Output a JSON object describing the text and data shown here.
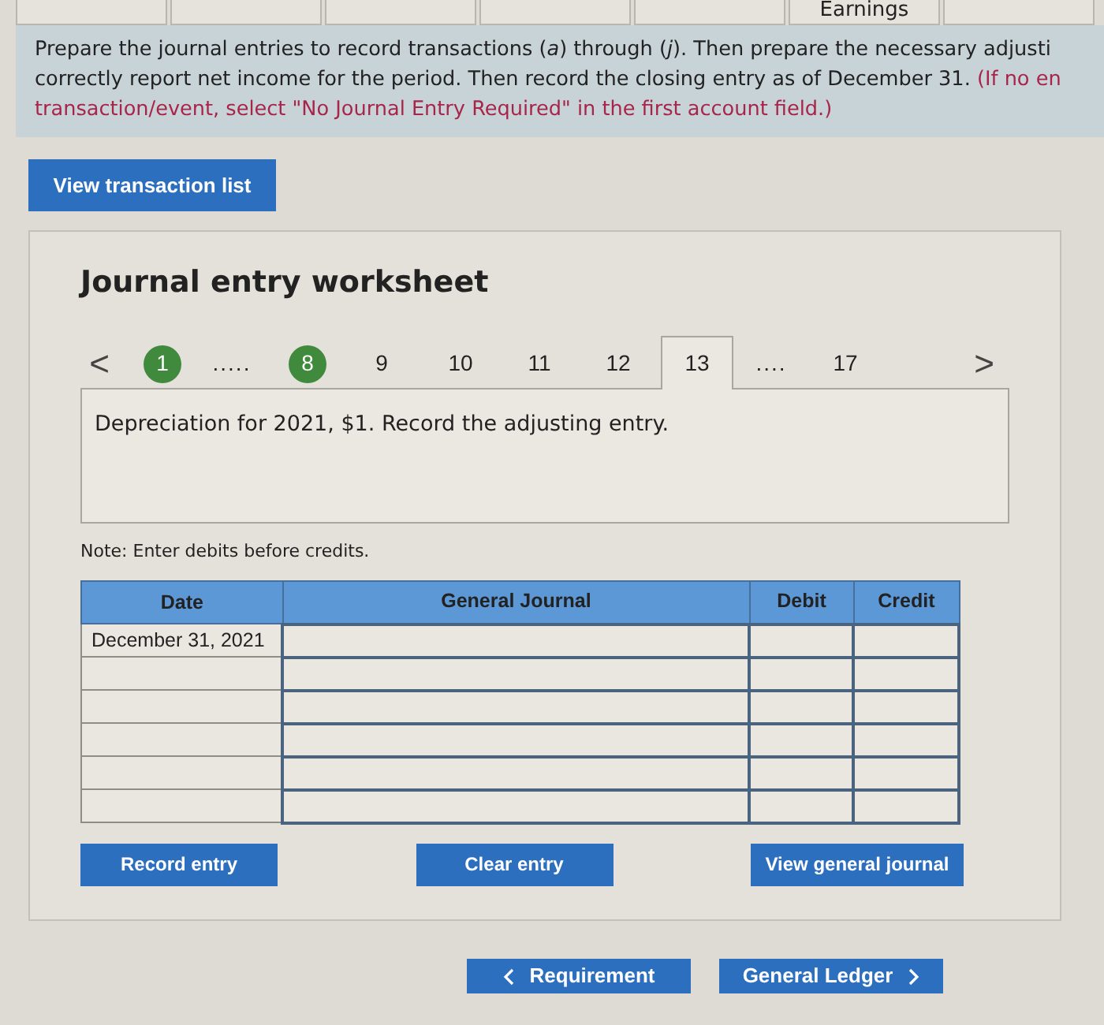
{
  "top_tabs": [
    {
      "kind": "cut"
    },
    {
      "kind": "cut"
    },
    {
      "kind": "cut"
    },
    {
      "kind": "cut"
    },
    {
      "kind": "cut"
    },
    {
      "kind": "label",
      "label": "Earnings"
    },
    {
      "kind": "cut"
    }
  ],
  "instructions": {
    "lines": [
      "Prepare the journal entries to record transactions (*a*) through (*j*). Then prepare the necessary adjusti",
      "correctly report net income for the period. Then record the closing entry as of December 31."
    ],
    "note_lines": [
      "(If no en",
      "transaction/event, select \"No Journal Entry Required\" in the first account field.)"
    ]
  },
  "view_transactions_button": "View transaction list",
  "worksheet": {
    "title": "Journal entry worksheet",
    "pager": [
      {
        "kind": "prev",
        "label": "<"
      },
      {
        "kind": "done",
        "label": "1"
      },
      {
        "kind": "dots",
        "label": "....."
      },
      {
        "kind": "done",
        "label": "8"
      },
      {
        "kind": "number",
        "label": "9",
        "selected": false
      },
      {
        "kind": "number",
        "label": "10",
        "selected": false
      },
      {
        "kind": "number",
        "label": "11",
        "selected": false
      },
      {
        "kind": "number",
        "label": "12",
        "selected": false
      },
      {
        "kind": "number",
        "label": "13",
        "selected": true
      },
      {
        "kind": "dots",
        "label": "...."
      },
      {
        "kind": "number",
        "label": "17",
        "selected": false
      },
      {
        "kind": "next",
        "label": ">"
      }
    ],
    "description": "Depreciation for 2021, $1. Record the adjusting entry.",
    "note": "Note: Enter debits before credits.",
    "table": {
      "columns": [
        "Date",
        "General Journal",
        "Debit",
        "Credit"
      ],
      "rows": [
        {
          "date": "December 31, 2021"
        },
        {
          "date": ""
        },
        {
          "date": ""
        },
        {
          "date": ""
        },
        {
          "date": ""
        },
        {
          "date": ""
        }
      ]
    },
    "buttons": [
      "Record entry",
      "Clear entry",
      "View general journal"
    ]
  },
  "nav": [
    {
      "kind": "back",
      "label": "Requirement"
    },
    {
      "kind": "forward",
      "label": "General Ledger"
    }
  ]
}
